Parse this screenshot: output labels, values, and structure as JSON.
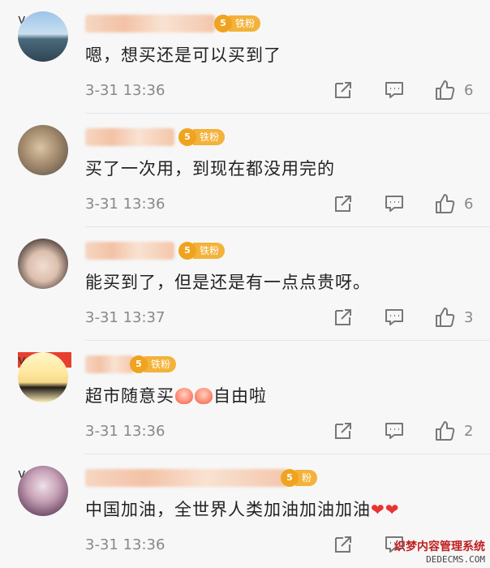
{
  "comments": [
    {
      "text": "嗯，想买还是可以买到了",
      "time": "3-31 13:36",
      "likes": "6",
      "badge": "铁粉"
    },
    {
      "text": "买了一次用，到现在都没用完的",
      "time": "3-31 13:36",
      "likes": "6",
      "badge": "铁粉"
    },
    {
      "text": "能买到了，但是还是有一点点贵呀。",
      "time": "3-31 13:37",
      "likes": "3",
      "badge": "铁粉"
    },
    {
      "text_before": "超市随意买",
      "text_after": "自由啦",
      "time": "3-31 13:36",
      "likes": "2",
      "badge": "铁粉"
    },
    {
      "text": "中国加油，全世界人类加油加油加油",
      "time": "3-31 13:36",
      "likes": "",
      "badge": "粉"
    }
  ],
  "icons": {
    "share": "share-icon",
    "reply": "comment-icon",
    "like": "thumbs-up-icon",
    "verified": "verified-v-icon",
    "fan_crown": "crown-icon"
  },
  "colors": {
    "badge": "#f3b23a",
    "heart": "#e8342e",
    "meta": "#888888"
  },
  "watermark": {
    "line1": "织梦内容管理系统",
    "line2": "DEDECMS.COM"
  }
}
